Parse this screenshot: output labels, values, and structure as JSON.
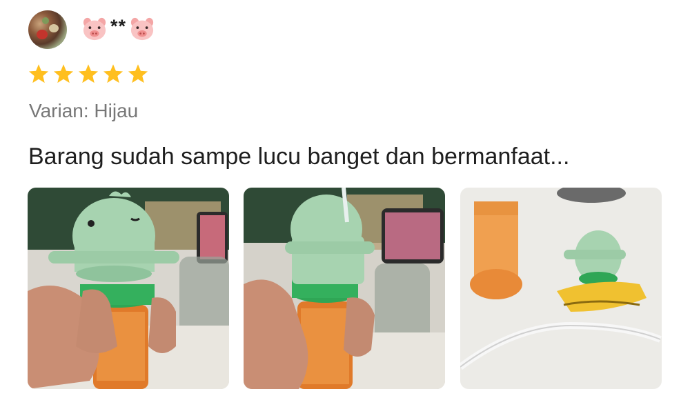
{
  "review": {
    "avatar_icon": "user-avatar-photo",
    "username": "**",
    "username_icon": "pig-face-icon",
    "rating": 5,
    "rating_max": 5,
    "star_color": "#FFBF1F",
    "variant": "Varian: Hijau",
    "text": "Barang sudah sampe lucu banget dan bermanfaat...",
    "photos": [
      {
        "icon": "product-photo-front"
      },
      {
        "icon": "product-photo-side"
      },
      {
        "icon": "product-photo-parts"
      }
    ]
  }
}
